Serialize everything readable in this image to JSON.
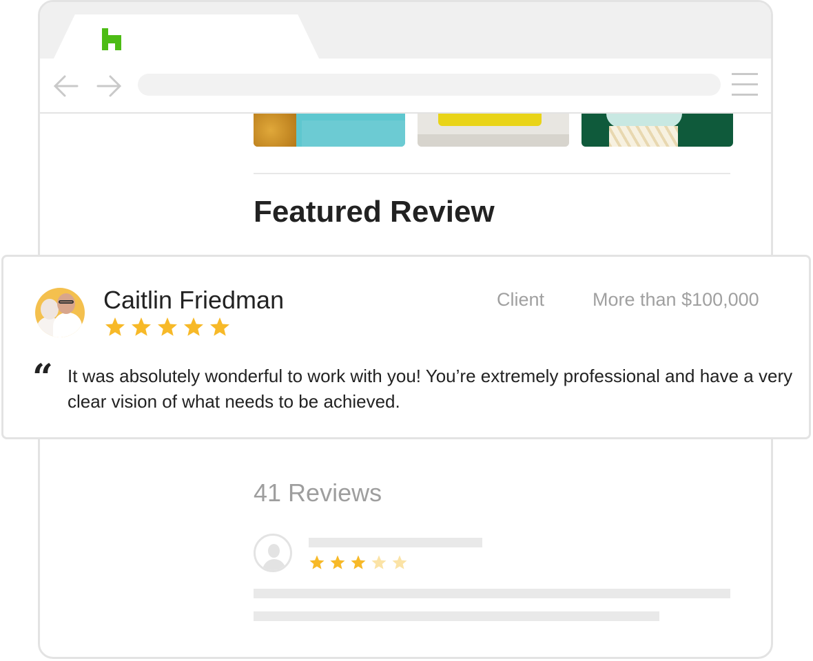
{
  "browser": {
    "tab_logo": "houzz-logo-icon",
    "brand_color": "#4dbc15",
    "nav": {
      "back_icon": "arrow-left-icon",
      "forward_icon": "arrow-right-icon",
      "menu_icon": "hamburger-menu-icon"
    }
  },
  "featured": {
    "title": "Featured Review",
    "review": {
      "reviewer_name": "Caitlin Friedman",
      "rating": 5,
      "role": "Client",
      "budget": "More than $100,000",
      "quote": "It was absolutely wonderful to work with you! You’re extremely professional and have a very clear vision of what needs to be achieved."
    }
  },
  "reviews": {
    "count_label": "41 Reviews",
    "placeholder_rating": 3
  },
  "colors": {
    "star": "#f7b928",
    "star_faded": "#fbe3a6",
    "text": "#222222",
    "muted": "#a0a0a0"
  }
}
